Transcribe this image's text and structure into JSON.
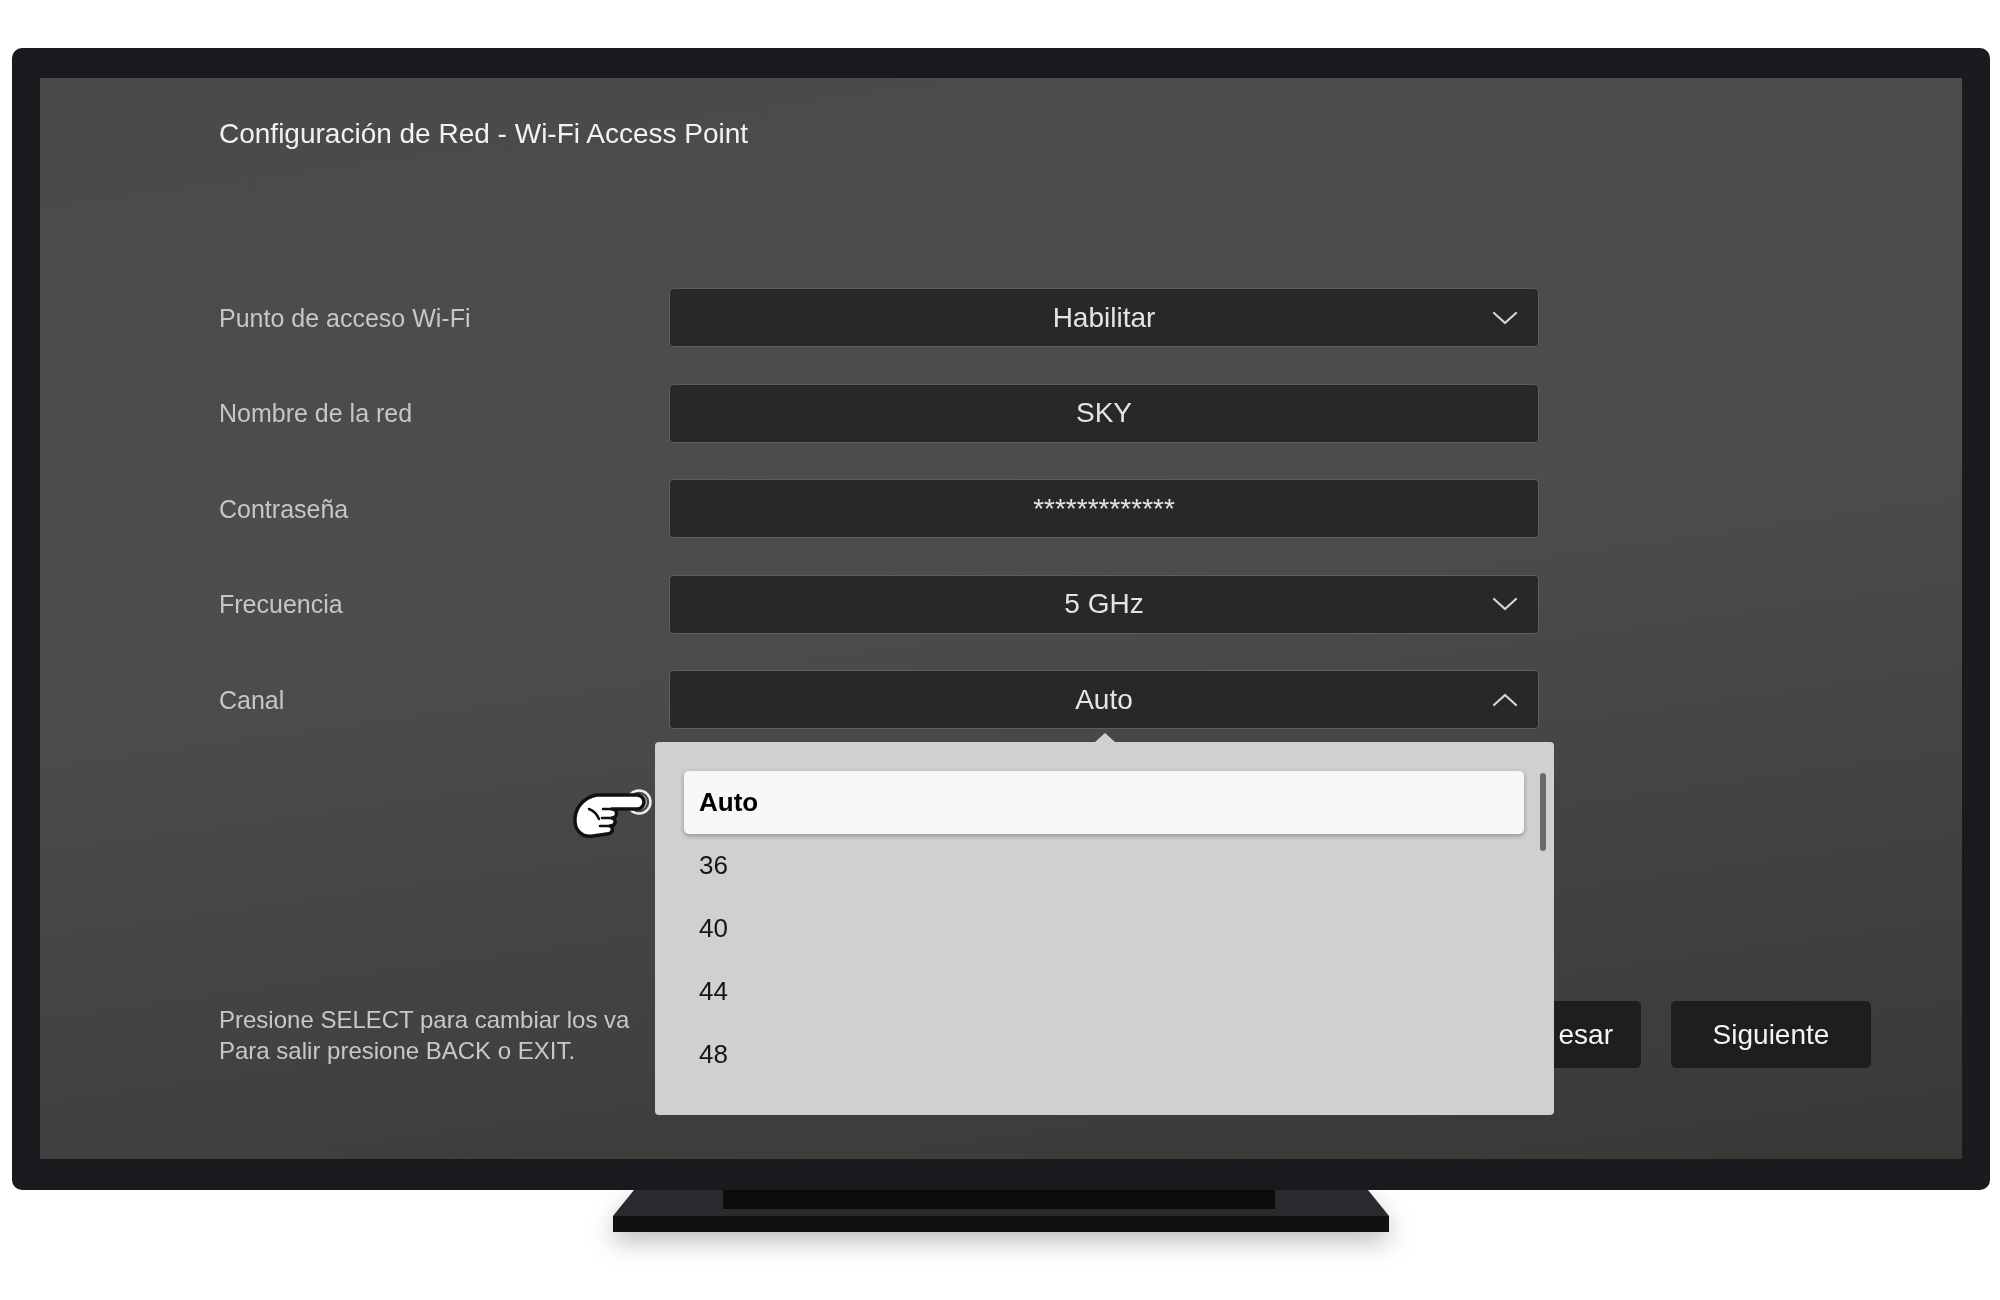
{
  "title": "Configuración de Red - Wi-Fi Access Point",
  "fields": [
    {
      "label": "Punto de acceso Wi-Fi",
      "kind": "dropdown",
      "value": "Habilitar",
      "expanded": false
    },
    {
      "label": "Nombre de la red",
      "kind": "text",
      "value": "SKY"
    },
    {
      "label": "Contraseña",
      "kind": "text",
      "value": "*************"
    },
    {
      "label": "Frecuencia",
      "kind": "dropdown",
      "value": "5 GHz",
      "expanded": false
    },
    {
      "label": "Canal",
      "kind": "dropdown",
      "value": "Auto",
      "expanded": true,
      "options": [
        {
          "label": "Auto",
          "selected": true
        },
        {
          "label": "36",
          "selected": false
        },
        {
          "label": "40",
          "selected": false
        },
        {
          "label": "44",
          "selected": false
        },
        {
          "label": "48",
          "selected": false
        }
      ]
    }
  ],
  "help_text": [
    "Presione SELECT para cambiar los va",
    "Para salir presione BACK o EXIT."
  ],
  "buttons": [
    "esar",
    "Siguiente"
  ]
}
